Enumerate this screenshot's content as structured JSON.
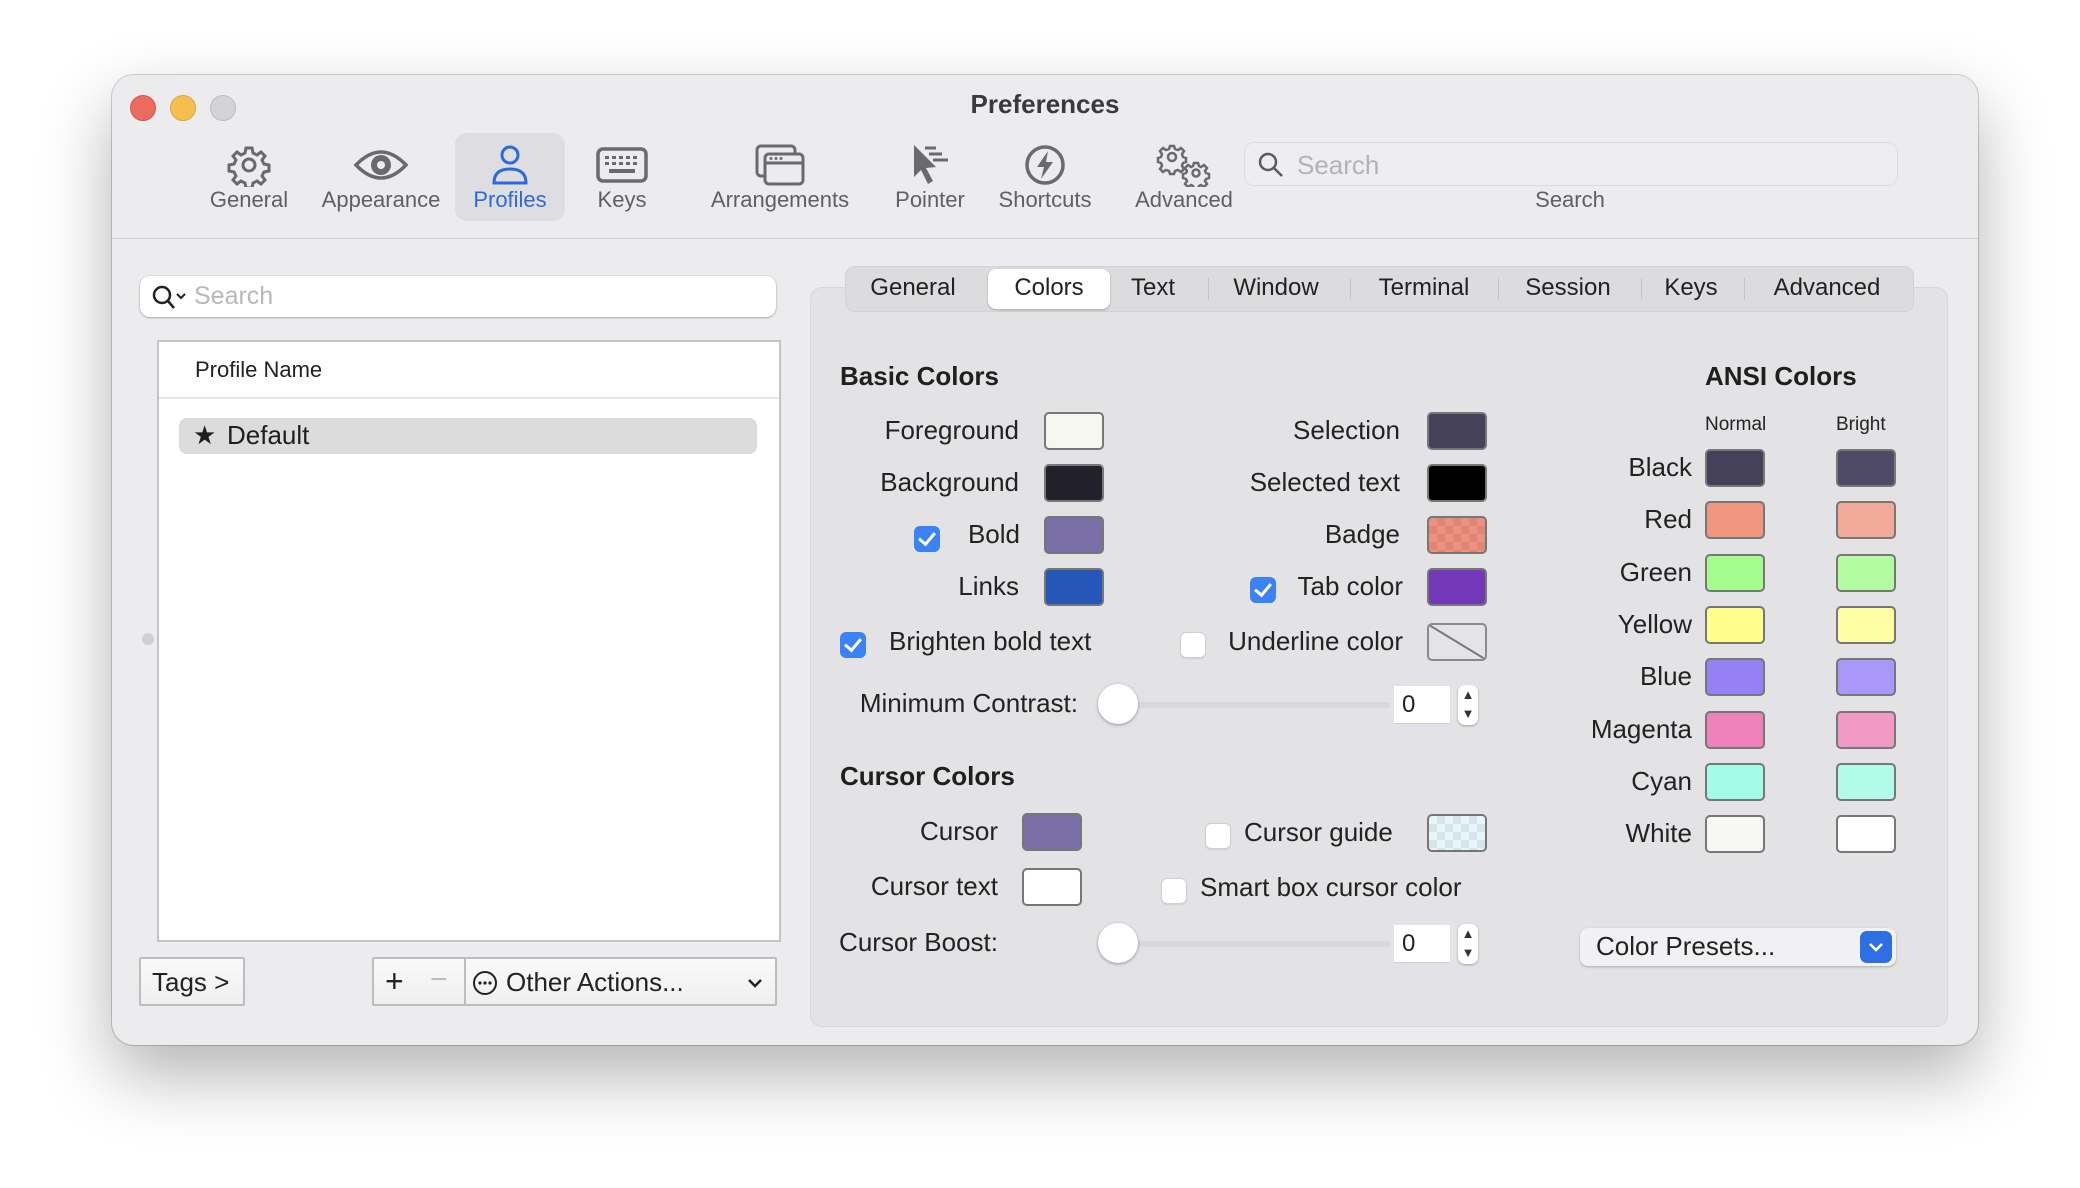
{
  "window": {
    "title": "Preferences",
    "traffic_lights": {
      "close": "#ec6a5e",
      "minimize": "#f4bf4f",
      "zoom": "#d4d4d6"
    }
  },
  "toolbar": {
    "items": [
      {
        "label": "General",
        "icon": "gear-icon",
        "active": false
      },
      {
        "label": "Appearance",
        "icon": "eye-icon",
        "active": false
      },
      {
        "label": "Profiles",
        "icon": "person-icon",
        "active": true
      },
      {
        "label": "Keys",
        "icon": "keyboard-icon",
        "active": false
      },
      {
        "label": "Arrangements",
        "icon": "windows-icon",
        "active": false
      },
      {
        "label": "Pointer",
        "icon": "pointer-icon",
        "active": false
      },
      {
        "label": "Shortcuts",
        "icon": "bolt-icon",
        "active": false
      },
      {
        "label": "Advanced",
        "icon": "gears-icon",
        "active": false
      }
    ],
    "search": {
      "placeholder": "Search",
      "label": "Search"
    },
    "accent": "#2d6ad9"
  },
  "profiles": {
    "search_placeholder": "Search",
    "column_header": "Profile Name",
    "rows": [
      {
        "name": "Default",
        "is_default": true,
        "selected": true
      }
    ],
    "tags_button": "Tags >",
    "add_button": "+",
    "remove_button": "−",
    "other_actions": "Other Actions..."
  },
  "tabs": {
    "items": [
      "General",
      "Colors",
      "Text",
      "Window",
      "Terminal",
      "Session",
      "Keys",
      "Advanced"
    ],
    "selected": "Colors"
  },
  "basic_colors": {
    "heading": "Basic Colors",
    "left": [
      {
        "label": "Foreground",
        "color": "#f7f7f2",
        "checkbox": null
      },
      {
        "label": "Background",
        "color": "#22212b",
        "checkbox": null
      },
      {
        "label": "Bold",
        "color": "#7a6fa6",
        "checkbox": true
      },
      {
        "label": "Links",
        "color": "#2557b8",
        "checkbox": null
      }
    ],
    "right": [
      {
        "label": "Selection",
        "color": "#454158",
        "checkbox": null
      },
      {
        "label": "Selected text",
        "color": "#000000",
        "checkbox": null
      },
      {
        "label": "Badge",
        "color": "#f0917f",
        "checkbox": null
      },
      {
        "label": "Tab color",
        "color": "#7339b8",
        "checkbox": true
      }
    ],
    "brighten_bold": {
      "label": "Brighten bold text",
      "checked": true
    },
    "underline": {
      "label": "Underline color",
      "checked": false
    },
    "min_contrast": {
      "label": "Minimum Contrast:",
      "value": "0",
      "slider_fraction": 0
    }
  },
  "cursor_colors": {
    "heading": "Cursor Colors",
    "cursor": {
      "label": "Cursor",
      "color": "#7a6fa6"
    },
    "cursor_text": {
      "label": "Cursor text",
      "color": "#ffffff"
    },
    "cursor_guide": {
      "label": "Cursor guide",
      "checked": false,
      "color": "#e6f6fb"
    },
    "smart_box": {
      "label": "Smart box cursor color",
      "checked": false
    },
    "cursor_boost": {
      "label": "Cursor Boost:",
      "value": "0",
      "slider_fraction": 0
    }
  },
  "ansi": {
    "heading": "ANSI Colors",
    "normal_label": "Normal",
    "bright_label": "Bright",
    "rows": [
      {
        "name": "Black",
        "normal": "#454158",
        "bright": "#4e4a66"
      },
      {
        "name": "Red",
        "normal": "#f0957f",
        "bright": "#f2aa98"
      },
      {
        "name": "Green",
        "normal": "#a3fc8b",
        "bright": "#b3fca0"
      },
      {
        "name": "Yellow",
        "normal": "#fefe8c",
        "bright": "#fefea4"
      },
      {
        "name": "Blue",
        "normal": "#9580f6",
        "bright": "#a998f7"
      },
      {
        "name": "Magenta",
        "normal": "#ef82b8",
        "bright": "#f19ac6"
      },
      {
        "name": "Cyan",
        "normal": "#a2fbe6",
        "bright": "#b2fbea"
      },
      {
        "name": "White",
        "normal": "#f7f7f3",
        "bright": "#ffffff"
      }
    ],
    "presets_label": "Color Presets..."
  }
}
